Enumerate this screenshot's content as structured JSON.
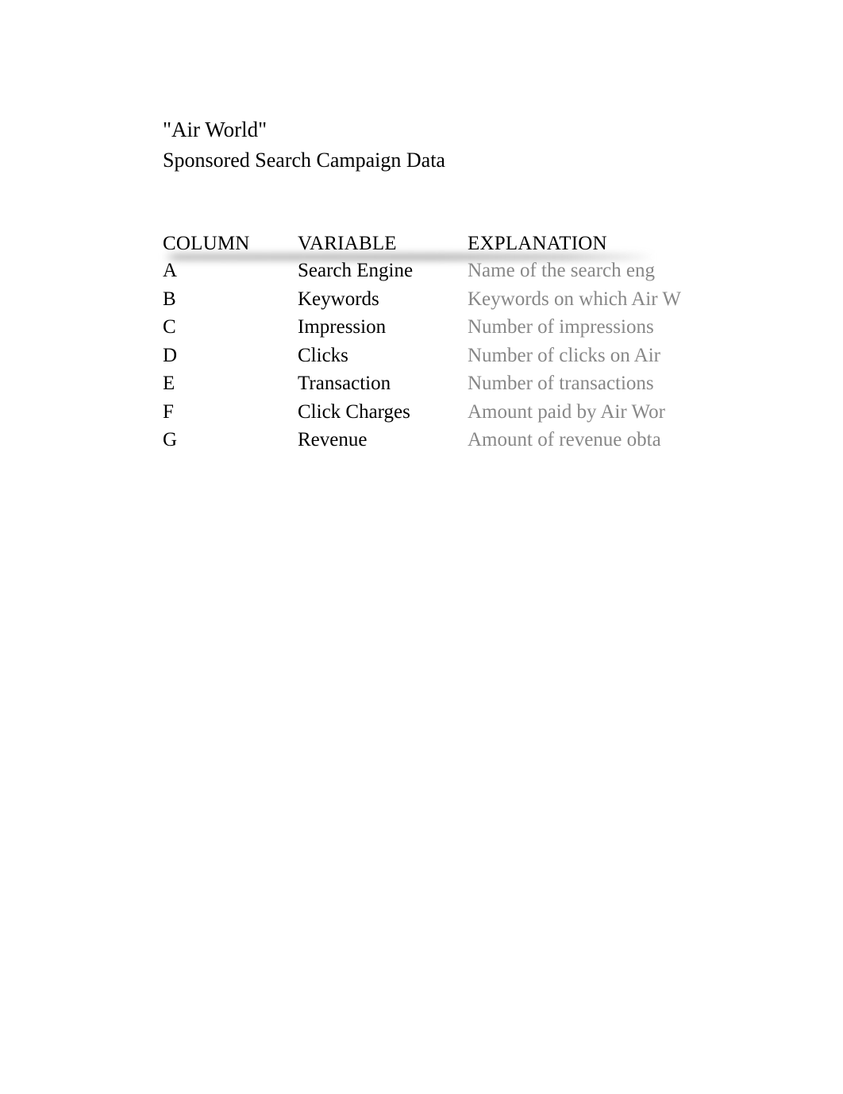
{
  "document": {
    "title": "\"Air World\"",
    "subtitle": "Sponsored Search Campaign Data"
  },
  "table": {
    "headers": {
      "column": "COLUMN",
      "variable": "VARIABLE",
      "explanation": "EXPLANATION"
    },
    "rows": [
      {
        "column": "A",
        "variable": "Search Engine",
        "explanation": "Name of the search eng"
      },
      {
        "column": "B",
        "variable": "Keywords",
        "explanation": "Keywords on which Air W"
      },
      {
        "column": "C",
        "variable": "Impression",
        "explanation": "Number of impressions"
      },
      {
        "column": "D",
        "variable": "Clicks",
        "explanation": "Number of clicks on Air"
      },
      {
        "column": "E",
        "variable": "Transaction",
        "explanation": "Number of transactions"
      },
      {
        "column": "F",
        "variable": "Click Charges",
        "explanation": "Amount paid by Air Wor"
      },
      {
        "column": "G",
        "variable": "Revenue",
        "explanation": "Amount of revenue obta"
      }
    ]
  },
  "colors": {
    "page_background": "#ffffff",
    "primary_text": "#000000",
    "explanation_text": "#878787",
    "header_shadow": "#787878"
  }
}
